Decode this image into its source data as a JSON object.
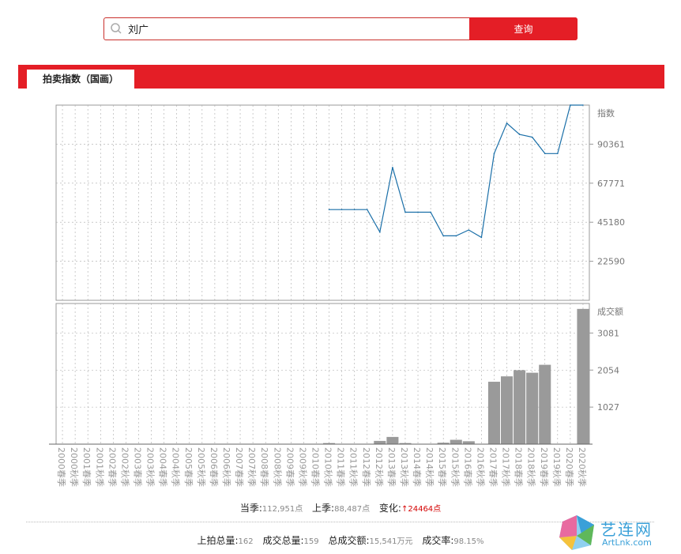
{
  "search": {
    "value": "刘广",
    "button_label": "查询"
  },
  "section": {
    "tab_label": "拍卖指数（国画）"
  },
  "chart_data": {
    "type": "line",
    "categories": [
      "2000春季",
      "2000秋季",
      "2001春季",
      "2001秋季",
      "2002春季",
      "2002秋季",
      "2003春季",
      "2003秋季",
      "2004春季",
      "2004秋季",
      "2005春季",
      "2005秋季",
      "2006春季",
      "2006秋季",
      "2007春季",
      "2007秋季",
      "2008春季",
      "2008秋季",
      "2009春季",
      "2009秋季",
      "2010春季",
      "2010秋季",
      "2011春季",
      "2011秋季",
      "2012春季",
      "2012秋季",
      "2013春季",
      "2013秋季",
      "2014春季",
      "2014秋季",
      "2015春季",
      "2015秋季",
      "2016春季",
      "2016秋季",
      "2017春季",
      "2017秋季",
      "2018春季",
      "2018秋季",
      "2019春季",
      "2019秋季",
      "2020春季",
      "2020秋季"
    ],
    "index_panel": {
      "ylabel": "指数",
      "yticks": [
        22590,
        45180,
        67771,
        90361
      ],
      "ylim": [
        0,
        112951
      ],
      "values": [
        null,
        null,
        null,
        null,
        null,
        null,
        null,
        null,
        null,
        null,
        null,
        null,
        null,
        null,
        null,
        null,
        null,
        null,
        null,
        null,
        null,
        52500,
        52500,
        52500,
        52500,
        39500,
        76900,
        51000,
        51000,
        51000,
        37300,
        37300,
        40700,
        36400,
        84900,
        102500,
        96000,
        94400,
        84900,
        84900,
        112951,
        112951
      ]
    },
    "volume_panel": {
      "type": "bar",
      "ylabel": "成交额",
      "yticks": [
        1027,
        2054,
        3081
      ],
      "ylim": [
        0,
        3900
      ],
      "values": [
        0,
        0,
        0,
        0,
        0,
        0,
        0,
        0,
        0,
        0,
        0,
        0,
        0,
        0,
        0,
        0,
        0,
        0,
        0,
        0,
        0,
        30,
        0,
        0,
        0,
        90,
        200,
        30,
        0,
        0,
        40,
        120,
        80,
        0,
        1730,
        1880,
        2050,
        1980,
        2200,
        0,
        0,
        3750
      ]
    },
    "grid": true
  },
  "stats": {
    "current_label": "当季:",
    "current_value": "112,951点",
    "previous_label": "上季:",
    "previous_value": "88,487点",
    "change_label": "变化:",
    "change_value": "24464点",
    "total_lots_label": "上拍总量:",
    "total_lots_value": "162",
    "sold_lots_label": "成交总量:",
    "sold_lots_value": "159",
    "turnover_label": "总成交额:",
    "turnover_value": "15,541万元",
    "rate_label": "成交率:",
    "rate_value": "98.15%"
  },
  "logo": {
    "cn": "艺连网",
    "en": "ArtLnk.com"
  },
  "colors": {
    "brand_red": "#e41e26",
    "line": "#1a6fa8",
    "bar": "#9a9a9a",
    "up_arrow": "#d40000"
  }
}
